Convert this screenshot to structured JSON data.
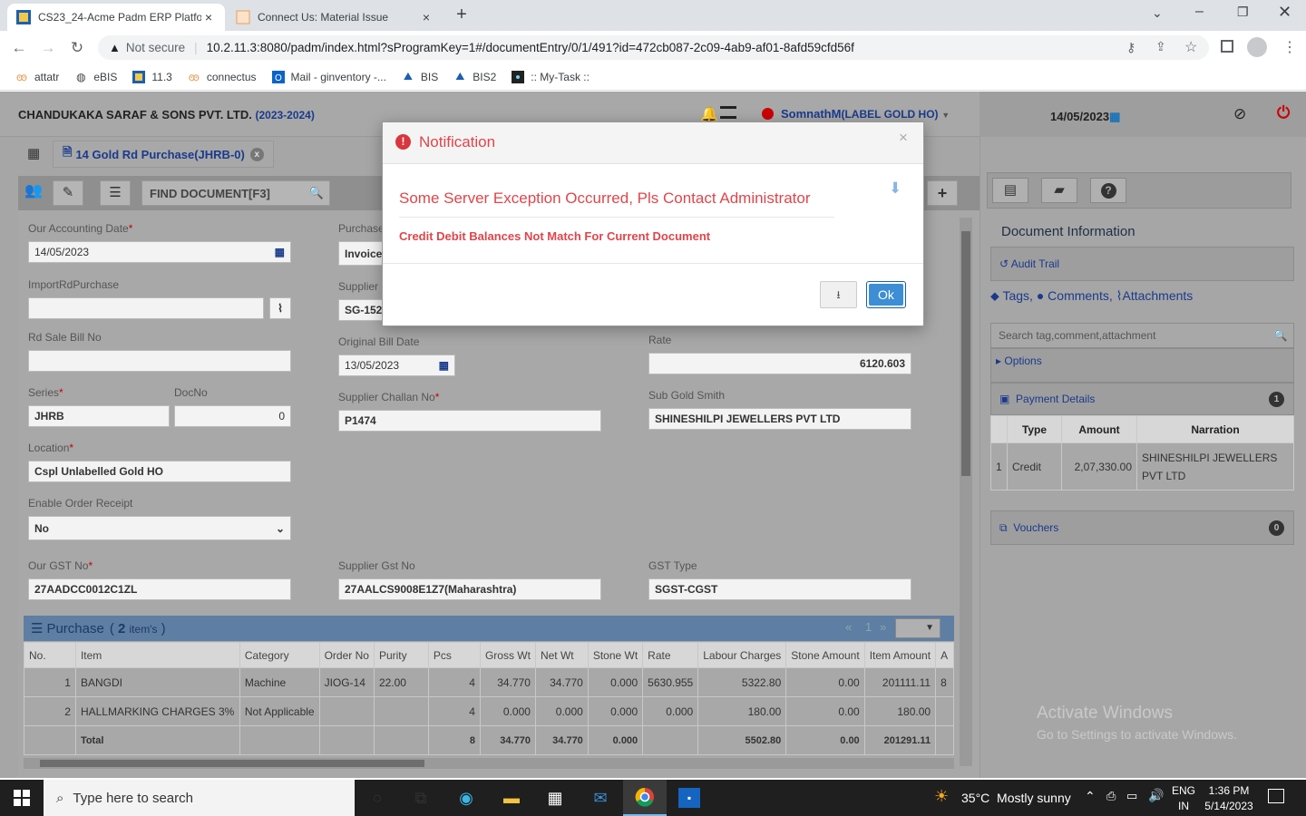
{
  "browser": {
    "tabs": [
      {
        "title": "CS23_24-Acme Padm ERP Platfor",
        "close": "×"
      },
      {
        "title": "Connect Us: Material Issue",
        "close": "×"
      }
    ],
    "new_tab": "+",
    "security": "Not secure",
    "url": "10.2.11.3:8080/padm/index.html?sProgramKey=1#/documentEntry/0/1/491?id=472cb087-2c09-4ab9-af01-8afd59cfd56f",
    "bookmarks": [
      "attatr",
      "eBIS",
      "11.3",
      "connectus",
      "Mail - ginventory -...",
      "BIS",
      "BIS2",
      ":: My-Task ::"
    ]
  },
  "header": {
    "company": "CHANDUKAKA SARAF & SONS PVT. LTD.",
    "year": "(2023-2024)",
    "user": "SomnathM",
    "user_loc": "(LABEL GOLD HO)",
    "date": "14/05/2023"
  },
  "doc": {
    "tab_title": "14 Gold Rd Purchase(JHRB-0)",
    "find_placeholder": "FIND DOCUMENT[F3]"
  },
  "form": {
    "acct_date_label": "Our Accounting Date",
    "acct_date": "14/05/2023",
    "import_label": "ImportRdPurchase",
    "rd_sale_label": "Rd Sale Bill No",
    "series_label": "Series",
    "series": "JHRB",
    "docno_label": "DocNo",
    "docno": "0",
    "location_label": "Location",
    "location": "Cspl Unlabelled Gold HO",
    "order_receipt_label": "Enable Order Receipt",
    "order_receipt": "No",
    "our_gst_label": "Our GST No",
    "our_gst": "27AADCC0012C1ZL",
    "purchase_label": "Purchase",
    "purchase": "Invoice",
    "supplier_label": "Supplier",
    "supplier": "SG-152",
    "orig_bill_label": "Original Bill Date",
    "orig_bill": "13/05/2023",
    "challan_label": "Supplier Challan No",
    "challan": "P1474",
    "supp_gst_label": "Supplier Gst No",
    "supp_gst": "27AALCS9008E1Z7(Maharashtra)",
    "rate_label": "Rate",
    "rate": "6120.603",
    "subsmith_label": "Sub Gold Smith",
    "subsmith": "SHINESHILPI JEWELLERS PVT LTD",
    "gst_type_label": "GST Type",
    "gst_type": "SGST-CGST"
  },
  "purchase_grid": {
    "title": "Purchase",
    "count": "2",
    "items_label": "item's",
    "pager": [
      "«",
      "1",
      "»"
    ],
    "headers": [
      "No.",
      "Item",
      "Category",
      "Order No",
      "Purity",
      "Pcs",
      "Gross Wt",
      "Net Wt",
      "Stone Wt",
      "Rate",
      "Labour Charges",
      "Stone Amount",
      "Item Amount",
      "A"
    ],
    "rows": [
      [
        "1",
        "BANGDI",
        "Machine",
        "JIOG-14",
        "22.00",
        "4",
        "34.770",
        "34.770",
        "0.000",
        "5630.955",
        "5322.80",
        "0.00",
        "201111.11",
        "8"
      ],
      [
        "2",
        "HALLMARKING CHARGES 3%",
        "Not Applicable",
        "",
        "",
        "4",
        "0.000",
        "0.000",
        "0.000",
        "0.000",
        "180.00",
        "0.00",
        "180.00",
        ""
      ]
    ],
    "total": [
      "",
      "Total",
      "",
      "",
      "",
      "8",
      "34.770",
      "34.770",
      "0.000",
      "",
      "5502.80",
      "0.00",
      "201291.11",
      ""
    ]
  },
  "side": {
    "doc_info": "Document Information",
    "audit": "Audit Trail",
    "tags": "Tags,",
    "comments": "Comments,",
    "attachments": "Attachments",
    "search_placeholder": "Search tag,comment,attachment",
    "options": "Options",
    "payment": "Payment Details",
    "payment_count": "1",
    "pay_headers": [
      "Type",
      "Amount",
      "Narration"
    ],
    "pay_row": [
      "1",
      "Credit",
      "2,07,330.00",
      "SHINESHILPI JEWELLERS PVT LTD"
    ],
    "vouchers": "Vouchers",
    "vouchers_count": "0"
  },
  "modal": {
    "title": "Notification",
    "message": "Some Server Exception Occurred, Pls Contact Administrator",
    "detail": "Credit Debit Balances Not Match For Current Document",
    "ok": "Ok",
    "close": "×"
  },
  "watermark": {
    "line1": "Activate Windows",
    "line2": "Go to Settings to activate Windows."
  },
  "taskbar": {
    "search": "Type here to search",
    "weather": "35°C  Mostly sunny",
    "lang1": "ENG",
    "lang2": "IN",
    "time": "1:36 PM",
    "date": "5/14/2023"
  },
  "colors": {
    "accent": "#1a73b8",
    "danger": "#d9363e",
    "modal_text": "#e0454b"
  }
}
